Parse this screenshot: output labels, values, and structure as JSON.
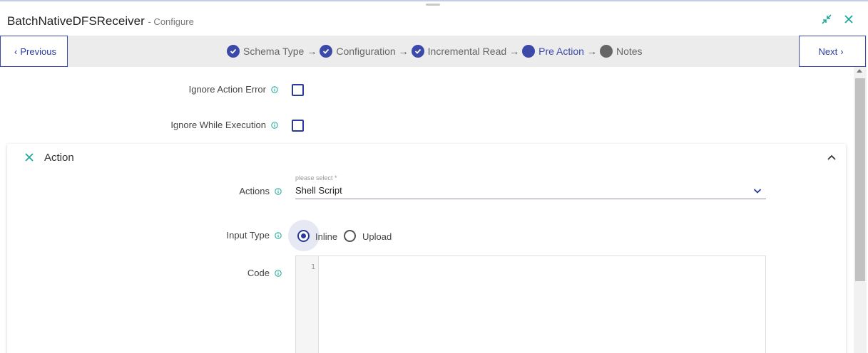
{
  "window": {
    "title": "BatchNativeDFSReceiver",
    "subtitle": "- Configure"
  },
  "nav": {
    "previous_label": "Previous",
    "next_label": "Next"
  },
  "steps": [
    {
      "label": "Schema Type",
      "state": "done"
    },
    {
      "label": "Configuration",
      "state": "done"
    },
    {
      "label": "Incremental Read",
      "state": "done"
    },
    {
      "label": "Pre Action",
      "state": "active"
    },
    {
      "label": "Notes",
      "state": "pending"
    }
  ],
  "step_arrow": "→",
  "fields": {
    "ignore_action_error": {
      "label": "Ignore Action Error",
      "checked": false
    },
    "ignore_while_execution": {
      "label": "Ignore While Execution",
      "checked": false
    }
  },
  "action_panel": {
    "title": "Action",
    "actions_label": "Actions",
    "select_hint": "please select *",
    "select_value": "Shell Script",
    "input_type_label": "Input Type",
    "input_type_options": [
      {
        "label": "Inline",
        "selected": true
      },
      {
        "label": "Upload",
        "selected": false
      }
    ],
    "code_label": "Code",
    "code_line_number": "1"
  },
  "colors": {
    "accent": "#3b4aa8",
    "teal_icon": "#1aa89a",
    "pending_step": "#666666"
  }
}
